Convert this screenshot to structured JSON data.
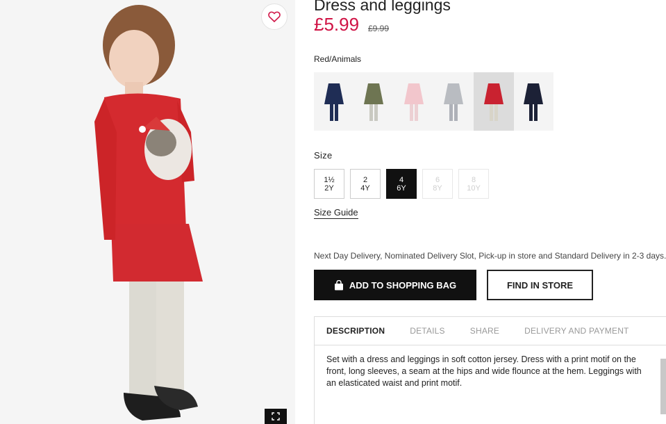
{
  "product": {
    "title": "Dress and leggings",
    "price": "£5.99",
    "old_price": "£9.99",
    "color_name": "Red/Animals"
  },
  "icons": {
    "favorite": "heart-icon",
    "fullscreen": "expand-icon",
    "bag": "shopping-bag-icon"
  },
  "swatches": [
    {
      "name": "navy",
      "dress": "#1f2d55",
      "legs": "#1f2d55"
    },
    {
      "name": "khaki",
      "dress": "#6e7552",
      "legs": "#c9c9c1"
    },
    {
      "name": "pink",
      "dress": "#f2c6cc",
      "legs": "#ecd0d3"
    },
    {
      "name": "grey",
      "dress": "#b9bcc1",
      "legs": "#aeb1b8"
    },
    {
      "name": "red",
      "dress": "#c92230",
      "legs": "#d8d4c8",
      "active": true
    },
    {
      "name": "dark-navy",
      "dress": "#1c2136",
      "legs": "#1c2136"
    }
  ],
  "size": {
    "label": "Size",
    "options": [
      {
        "top": "1½",
        "bottom": "2Y",
        "state": "normal"
      },
      {
        "top": "2",
        "bottom": "4Y",
        "state": "normal"
      },
      {
        "top": "4",
        "bottom": "6Y",
        "state": "selected"
      },
      {
        "top": "6",
        "bottom": "8Y",
        "state": "disabled"
      },
      {
        "top": "8",
        "bottom": "10Y",
        "state": "disabled"
      }
    ],
    "guide": "Size Guide"
  },
  "delivery_note": "Next Day Delivery, Nominated Delivery Slot, Pick-up in store and Standard Delivery in 2-3 days.",
  "buttons": {
    "add_to_bag": "ADD TO SHOPPING BAG",
    "find_in_store": "FIND IN STORE"
  },
  "tabs": [
    {
      "label": "DESCRIPTION",
      "active": true
    },
    {
      "label": "DETAILS",
      "active": false
    },
    {
      "label": "SHARE",
      "active": false
    },
    {
      "label": "DELIVERY AND PAYMENT",
      "active": false
    }
  ],
  "description": "Set with a dress and leggings in soft cotton jersey. Dress with a print motif on the front, long sleeves, a seam at the hips and wide flounce at the hem. Leggings with an elasticated waist and print motif.",
  "colors": {
    "sale_price": "#d01345",
    "primary_button": "#111111"
  }
}
